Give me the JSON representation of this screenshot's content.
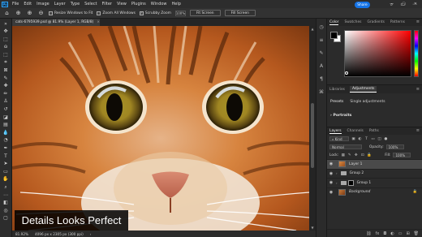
{
  "menubar": {
    "logo": "Ps",
    "items": [
      "File",
      "Edit",
      "Image",
      "Layer",
      "Type",
      "Select",
      "Filter",
      "View",
      "Plugins",
      "Window",
      "Help"
    ],
    "window_controls": [
      "—",
      "▢",
      "✕"
    ]
  },
  "options": {
    "resize_windows_label": "Resize Windows to Fit",
    "zoom_all_windows_label": "Zoom All Windows",
    "scrubby_zoom_label": "Scrubby Zoom",
    "zoom_percent": "100%",
    "fit_screen_label": "Fit Screen",
    "fill_screen_label": "Fill Screen",
    "share_label": "Share"
  },
  "document": {
    "tab_title": "cats-6795939.psd @ 81.9% (Layer 1, RGB/8)",
    "tab_close": "×",
    "status_zoom": "81.92%",
    "status_size": "4096 px x 2305 px (300 ppi)"
  },
  "caption": "Details Looks Perfect",
  "color_panel": {
    "tabs": [
      "Color",
      "Swatches",
      "Gradients",
      "Patterns"
    ],
    "active_tab": "Color",
    "foreground": "#000000",
    "background": "#ffffff",
    "hue": "#ff0000"
  },
  "adjustments_panel": {
    "tabs": [
      "Libraries",
      "Adjustments"
    ],
    "active_tab": "Adjustments",
    "presets_label": "Presets",
    "single_label": "Single adjustments",
    "section": "Portraits"
  },
  "layers_panel": {
    "tabs": [
      "Layers",
      "Channels",
      "Paths"
    ],
    "active_tab": "Layers",
    "filter_kind": "Kind",
    "blend_mode": "Normal",
    "opacity_label": "Opacity:",
    "opacity_value": "100%",
    "lock_label": "Lock:",
    "fill_label": "Fill:",
    "fill_value": "100%",
    "layers": [
      {
        "name": "Layer 1",
        "type": "pixel",
        "visible": true,
        "selected": true
      },
      {
        "name": "Group 2",
        "type": "group",
        "visible": true,
        "selected": false
      },
      {
        "name": "Group 1",
        "type": "group-mask",
        "visible": true,
        "selected": false
      },
      {
        "name": "Background",
        "type": "background",
        "visible": true,
        "selected": false
      }
    ]
  }
}
